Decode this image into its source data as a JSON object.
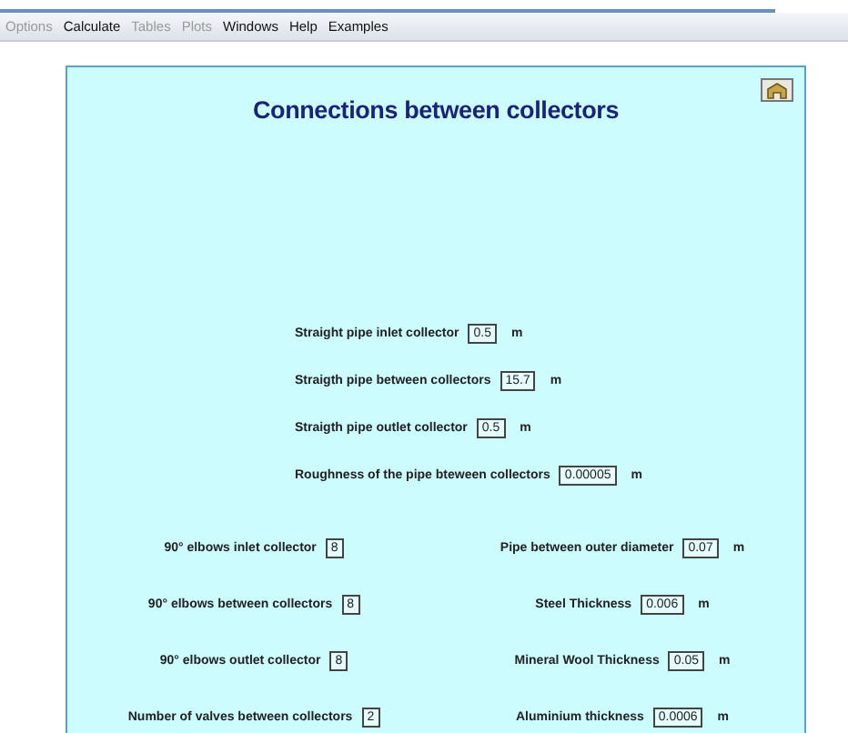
{
  "menu": [
    {
      "label": "Options",
      "disabled": true
    },
    {
      "label": "Calculate",
      "disabled": false
    },
    {
      "label": "Tables",
      "disabled": true
    },
    {
      "label": "Plots",
      "disabled": true
    },
    {
      "label": "Windows",
      "disabled": false
    },
    {
      "label": "Help",
      "disabled": false
    },
    {
      "label": "Examples",
      "disabled": false
    }
  ],
  "panel": {
    "title": "Connections between collectors",
    "pipe_fields": [
      {
        "label": "Straight pipe inlet collector",
        "value": "0.5",
        "unit": "m"
      },
      {
        "label": "Straigth pipe between collectors",
        "value": "15.7",
        "unit": "m"
      },
      {
        "label": "Straigth pipe outlet collector",
        "value": "0.5",
        "unit": "m"
      },
      {
        "label": "Roughness of the pipe bteween collectors",
        "value": "0.00005",
        "unit": "m"
      }
    ],
    "left_fields": [
      {
        "label": "90° elbows inlet collector",
        "value": "8"
      },
      {
        "label": "90° elbows between collectors",
        "value": "8"
      },
      {
        "label": "90° elbows outlet collector",
        "value": "8"
      },
      {
        "label": "Number of valves between collectors",
        "value": "2"
      }
    ],
    "right_fields": [
      {
        "label": "Pipe between outer diameter",
        "value": "0.07",
        "unit": "m"
      },
      {
        "label": "Steel Thickness",
        "value": "0.006",
        "unit": "m"
      },
      {
        "label": "Mineral Wool Thickness",
        "value": "0.05",
        "unit": "m"
      },
      {
        "label": "Aluminium thickness",
        "value": "0.0006",
        "unit": "m"
      }
    ]
  }
}
